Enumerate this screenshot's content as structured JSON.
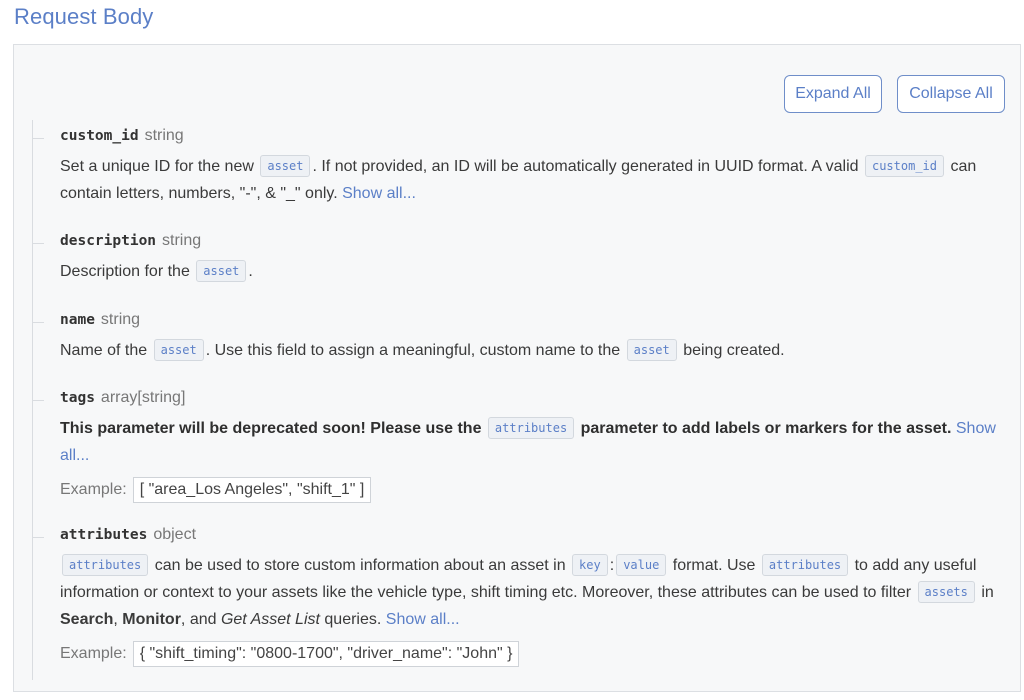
{
  "section": {
    "title": "Request Body"
  },
  "toolbar": {
    "expand_label": "Expand All",
    "collapse_label": "Collapse All"
  },
  "colors": {
    "accent": "#5b7fc7",
    "panel_bg": "#f7f8f9",
    "code_bg": "#eef1f5"
  },
  "params": {
    "custom_id": {
      "name": "custom_id",
      "type": "string",
      "desc_1": "Set a unique ID for the new ",
      "code_1": "asset",
      "desc_2": ". If not provided, an ID will be automatically generated in UUID format. A valid ",
      "code_2": "custom_id",
      "desc_3": " can contain letters, numbers, \"-\", & \"_\" only. ",
      "link": "Show all..."
    },
    "description": {
      "name": "description",
      "type": "string",
      "desc_1": "Description for the ",
      "code_1": "asset",
      "desc_2": "."
    },
    "name": {
      "name": "name",
      "type": "string",
      "desc_1": "Name of the ",
      "code_1": "asset",
      "desc_2": ". Use this field to assign a meaningful, custom name to the ",
      "code_2": "asset",
      "desc_3": " being created."
    },
    "tags": {
      "name": "tags",
      "type": "array[string]",
      "desc_1": "This parameter will be deprecated soon! Please use the ",
      "code_1": "attributes",
      "desc_2": " parameter to add labels or markers for the asset. ",
      "link": "Show all...",
      "example_label": "Example:",
      "example_value": "[ \"area_Los Angeles\", \"shift_1\" ]"
    },
    "attributes": {
      "name": "attributes",
      "type": "object",
      "code_1": "attributes",
      "desc_1": " can be used to store custom information about an asset in ",
      "code_2": "key",
      "desc_2": ":",
      "code_3": "value",
      "desc_3": " format. Use ",
      "code_4": "attributes",
      "desc_4": " to add any useful information or context to your assets like the vehicle type, shift timing etc. Moreover, these attributes can be used to filter ",
      "code_5": "assets",
      "desc_5": " in ",
      "bold_1": "Search",
      "desc_6": ", ",
      "bold_2": "Monitor",
      "desc_7": ", and ",
      "italic_1": "Get Asset List",
      "desc_8": " queries. ",
      "link": "Show all...",
      "example_label": "Example:",
      "example_value": "{ \"shift_timing\": \"0800-1700\", \"driver_name\": \"John\" }"
    }
  }
}
